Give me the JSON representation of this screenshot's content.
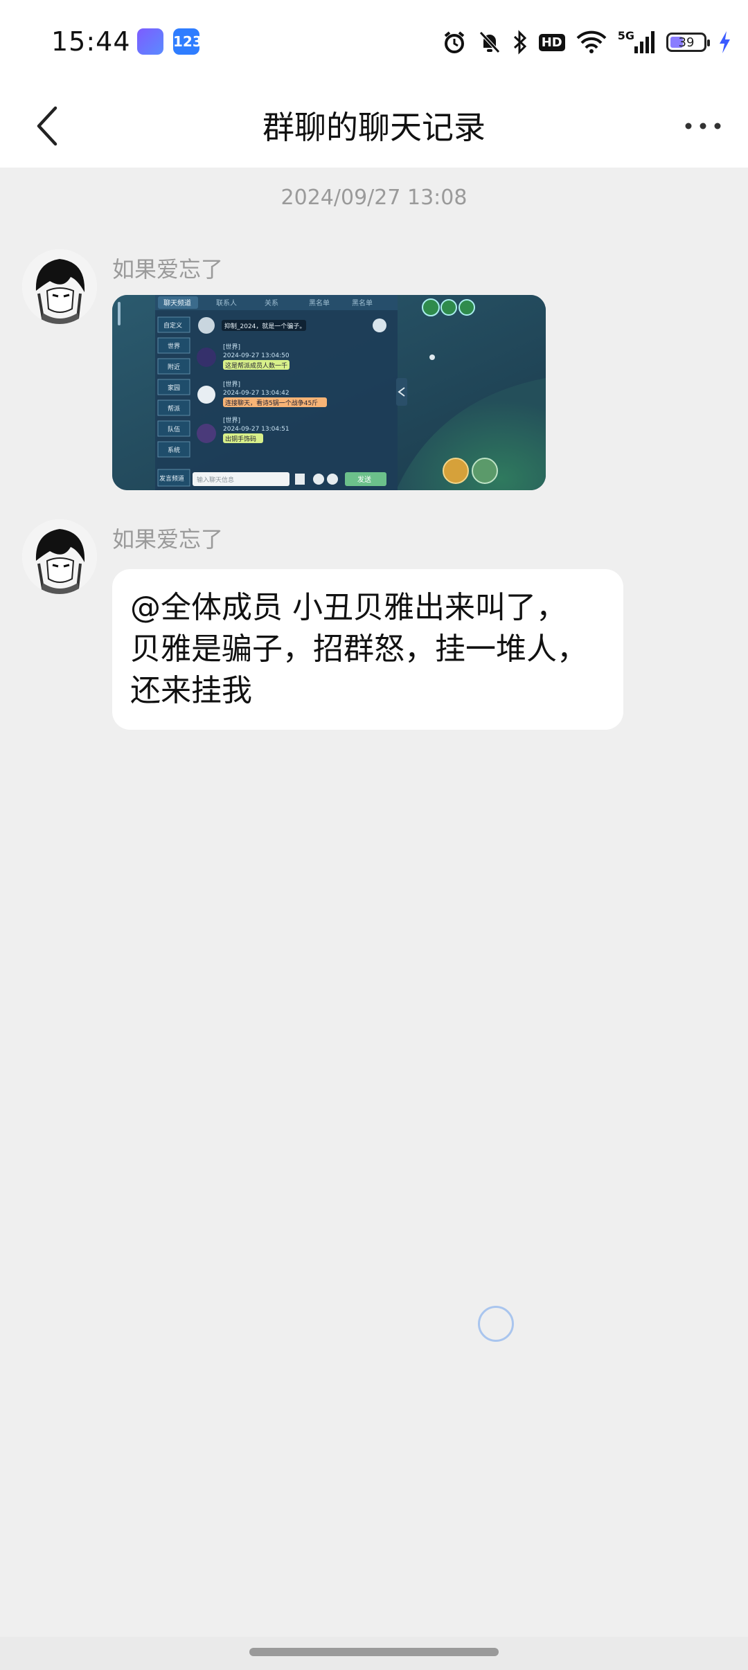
{
  "status_bar": {
    "time": "15:44",
    "app_badge_2": "123",
    "network_label": "5G",
    "hd_label": "HD",
    "battery_level": 39,
    "battery_text": "39",
    "icons": [
      "alarm-icon",
      "mute-bell-icon",
      "bluetooth-icon",
      "hd-icon",
      "wifi-icon",
      "signal-icon",
      "battery-icon",
      "charging-icon"
    ]
  },
  "header": {
    "title": "群聊的聊天记录",
    "back_icon": "chevron-left-icon",
    "more_icon": "more-dots-icon"
  },
  "chat": {
    "timestamp": "2024/09/27 13:08",
    "messages": [
      {
        "sender": "如果爱忘了",
        "type": "image"
      },
      {
        "sender": "如果爱忘了",
        "type": "text",
        "text_lines": [
          "@全体成员 小丑贝雅出来叫了，",
          "贝雅是骗子，招群怒，挂一堆人，",
          "还来挂我"
        ]
      }
    ]
  },
  "game_screenshot": {
    "tabs": [
      "聊天频道",
      "联系人",
      "关系",
      "黑名单",
      "黑名单"
    ],
    "sidebar": [
      "自定义",
      "世界",
      "附近",
      "家园",
      "帮派",
      "队伍",
      "系统",
      "发言频道"
    ],
    "entries": [
      {
        "meta": "[世界]",
        "time": "2024-09-27 13:04:50",
        "text": "这是帮派成员人数一千"
      },
      {
        "meta": "[世界]",
        "time": "2024-09-27 13:04:42",
        "text": "连接聊天，看诗5锅一个战争45斤"
      },
      {
        "meta": "[世界]",
        "time": "2024-09-27 13:04:51",
        "text": "出铜手饰码"
      }
    ],
    "input_placeholder": "输入聊天信息",
    "send_label": "发送",
    "top_bubble": "抑制_2024，就是一个骗子。"
  }
}
